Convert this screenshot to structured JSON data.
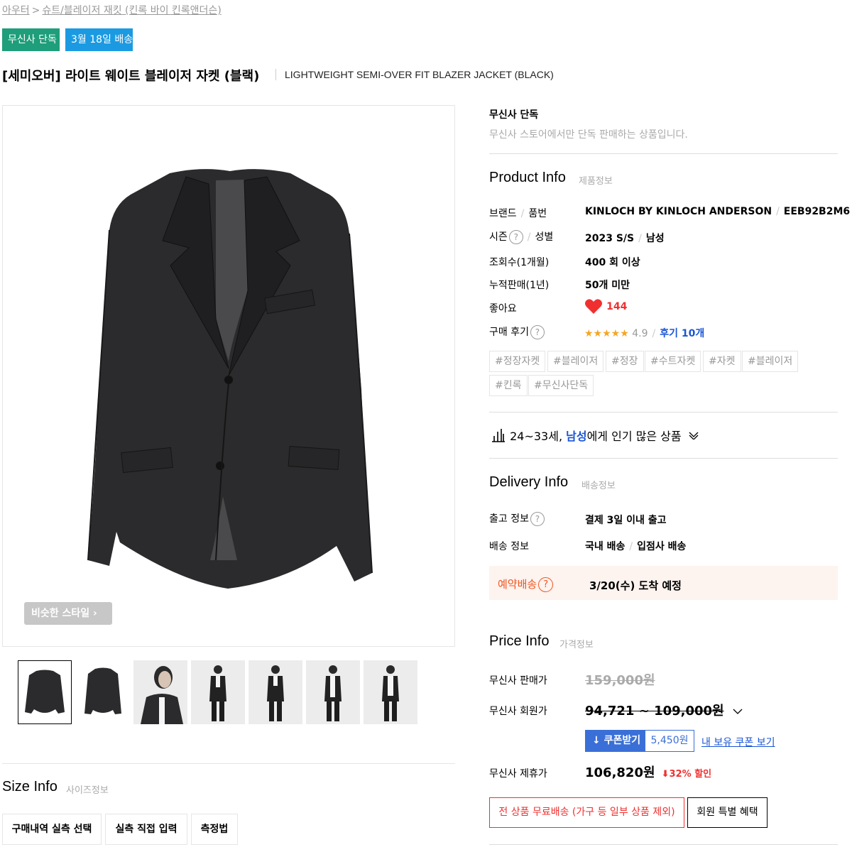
{
  "breadcrumb": {
    "category": "아우터",
    "separator": ">",
    "subcategory": "슈트/블레이저 재킷 (킨록 바이 킨록앤더슨)"
  },
  "badges": {
    "exclusive": "무신사 단독",
    "delivery": "3월 18일 배송"
  },
  "product": {
    "title_ko": "[세미오버] 라이트 웨이트 블레이저 자켓 (블랙)",
    "title_en": "LIGHTWEIGHT SEMI-OVER FIT BLAZER JACKET (BLACK)",
    "similar_style_label": "비슷한 스타일",
    "thumbnails": [
      "jacket-front",
      "jacket-back",
      "model-closeup",
      "model-full-1",
      "model-full-2",
      "model-full-3",
      "model-full-4"
    ]
  },
  "exclusive_notice": {
    "title": "무신사 단독",
    "description": "무신사 스토어에서만 단독 판매하는 상품입니다."
  },
  "product_info": {
    "title": "Product Info",
    "subtitle": "제품정보",
    "brand_label": "브랜드",
    "code_label": "품번",
    "brand": "KINLOCH BY KINLOCH ANDERSON",
    "code": "EEB92B2M6",
    "season_label": "시즌",
    "gender_label": "성별",
    "season": "2023 S/S",
    "gender": "남성",
    "views_label": "조회수(1개월)",
    "views": "400 회 이상",
    "sales_label": "누적판매(1년)",
    "sales": "50개 미만",
    "likes_label": "좋아요",
    "likes": "144",
    "review_label": "구매 후기",
    "stars": "★★★★★",
    "rating": "4.9",
    "review_count": "후기 10개",
    "tags": [
      "#정장자켓",
      "#블레이저",
      "#정장",
      "#수트자켓",
      "#자켓",
      "#블레이저",
      "#킨록",
      "#무신사단독"
    ]
  },
  "popular": {
    "age_range": "24~33세,",
    "gender": "남성",
    "suffix": "에게 인기 많은 상품"
  },
  "delivery_info": {
    "title": "Delivery Info",
    "subtitle": "배송정보",
    "release_label": "출고 정보",
    "release": "결제 3일 이내 출고",
    "shipping_label": "배송 정보",
    "shipping_domestic": "국내 배송",
    "shipping_store": "입점사 배송",
    "reserve_label": "예약배송",
    "reserve_date": "3/20(수) 도착 예정"
  },
  "price_info": {
    "title": "Price Info",
    "subtitle": "가격정보",
    "sale_label": "무신사 판매가",
    "sale_price": "159,000원",
    "member_label": "무신사 회원가",
    "member_price": "94,721 ~ 109,000원",
    "coupon_button": "쿠폰받기",
    "coupon_amount": "5,450원",
    "coupon_link": "내 보유 쿠폰 보기",
    "partner_label": "무신사 제휴가",
    "partner_price": "106,820원",
    "discount": "32% 할인",
    "free_shipping": "전 상품 무료배송 (가구 등 일부 상품 제외)",
    "member_benefit": "회원 특별 혜택"
  },
  "size_info": {
    "title": "Size Info",
    "subtitle": "사이즈정보",
    "buttons": [
      "구매내역 실측 선택",
      "실측 직접 입력",
      "측정법"
    ]
  },
  "colors": {
    "exclusive_badge": "#1e9e7a",
    "delivery_badge": "#1b9ae2",
    "like_red": "#f03030",
    "link_blue": "#1a55d6",
    "reserve_orange": "#f0541e",
    "star_orange": "#f5a623"
  }
}
